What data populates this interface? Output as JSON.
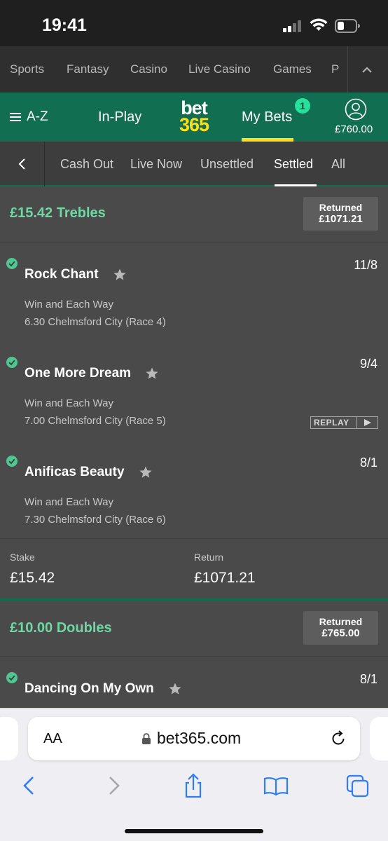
{
  "status_bar": {
    "time": "19:41"
  },
  "top_nav": {
    "items": [
      "Sports",
      "Fantasy",
      "Casino",
      "Live Casino",
      "Games",
      "P"
    ]
  },
  "header": {
    "az_label": "A-Z",
    "inplay_label": "In-Play",
    "logo_line1": "bet",
    "logo_line2": "365",
    "mybets_label": "My Bets",
    "mybets_badge": "1",
    "balance": "£760.00"
  },
  "filter_tabs": {
    "items": [
      "Cash Out",
      "Live Now",
      "Unsettled",
      "Settled",
      "All"
    ],
    "active": "Settled"
  },
  "bets": [
    {
      "title": "£15.42 Trebles",
      "returned_label": "Returned",
      "returned_value": "£1071.21",
      "selections": [
        {
          "name": "Rock Chant",
          "odds": "11/8",
          "market": "Win and Each Way",
          "race": "6.30 Chelmsford City (Race 4)"
        },
        {
          "name": "One More Dream",
          "odds": "9/4",
          "market": "Win and Each Way",
          "race": "7.00 Chelmsford City (Race 5)",
          "replay_label": "REPLAY"
        },
        {
          "name": "Anificas Beauty",
          "odds": "8/1",
          "market": "Win and Each Way",
          "race": "7.30 Chelmsford City (Race 6)"
        }
      ],
      "stake_label": "Stake",
      "stake_value": "£15.42",
      "return_label": "Return",
      "return_value": "£1071.21"
    },
    {
      "title": "£10.00 Doubles",
      "returned_label": "Returned",
      "returned_value": "£765.00",
      "selections": [
        {
          "name": "Dancing On My Own",
          "odds": "8/1"
        }
      ]
    }
  ],
  "browser": {
    "aa_label": "AA",
    "url": "bet365.com"
  },
  "colors": {
    "brand_green": "#126e51",
    "accent_yellow": "#ffdf1b",
    "bet_title_green": "#6fd7a3",
    "ios_blue": "#2f7cf6"
  }
}
